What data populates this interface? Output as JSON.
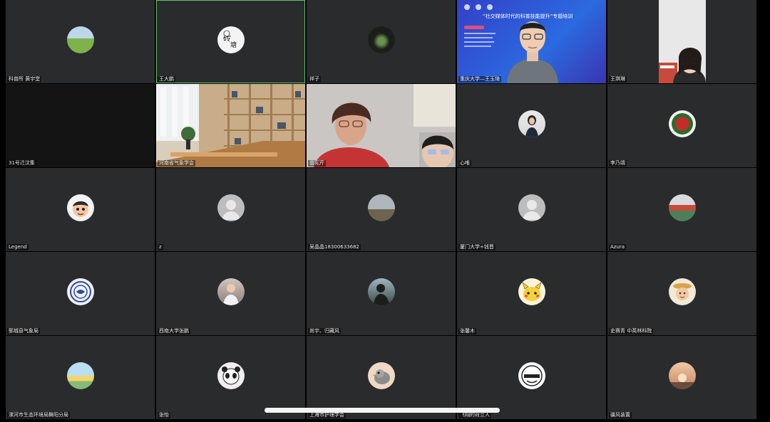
{
  "participants": [
    {
      "name": "科普所 黄宇堂",
      "avatar": "meadow-avatar"
    },
    {
      "name": "王大鹏",
      "avatar": "calligraphy-avatar",
      "active": true
    },
    {
      "name": "祥子",
      "avatar": "night-avatar"
    },
    {
      "name": "重庆大学—王玉琦",
      "video": "presenter",
      "slide_title": "“社交媒体时代的科普技能提升”专题培训"
    },
    {
      "name": "王琪琳",
      "video": "woman-webcam"
    },
    {
      "name": "31号迁汶集",
      "video": "dark"
    },
    {
      "name": "河南省气象学会",
      "video": "bookshelf-room"
    },
    {
      "name": "曾宪芹",
      "video": "older-woman"
    },
    {
      "name": "心唯",
      "avatar": "woman-avatar"
    },
    {
      "name": "李乃靖",
      "avatar": "flower-avatar"
    },
    {
      "name": "Legend",
      "avatar": "cartoon-boy-avatar"
    },
    {
      "name": "z",
      "avatar": "default-avatar"
    },
    {
      "name": "吴晶晶18300633682",
      "avatar": "city-avatar"
    },
    {
      "name": "厦门大学+钱晋",
      "avatar": "default-avatar"
    },
    {
      "name": "Azura",
      "avatar": "landscape-avatar"
    },
    {
      "name": "鄄城县气象局",
      "avatar": "badge-avatar"
    },
    {
      "name": "西南大学张鹏",
      "avatar": "man-photo-avatar"
    },
    {
      "name": "尚宇、归藏风",
      "avatar": "silhouette-avatar"
    },
    {
      "name": "张馨木",
      "avatar": "pikachu-avatar"
    },
    {
      "name": "史赛青 中英林科院",
      "avatar": "farmer-avatar"
    },
    {
      "name": "漯河市生态环境局舞阳分局",
      "avatar": "painting-avatar"
    },
    {
      "name": "张怡",
      "avatar": "panda-girl-avatar"
    },
    {
      "name": "上海市护理学会",
      "avatar": "bird-avatar"
    },
    {
      "name": "飞翔的荷兰人",
      "avatar": "mask-avatar"
    },
    {
      "name": "疆风装置",
      "avatar": "sunset-avatar"
    }
  ]
}
